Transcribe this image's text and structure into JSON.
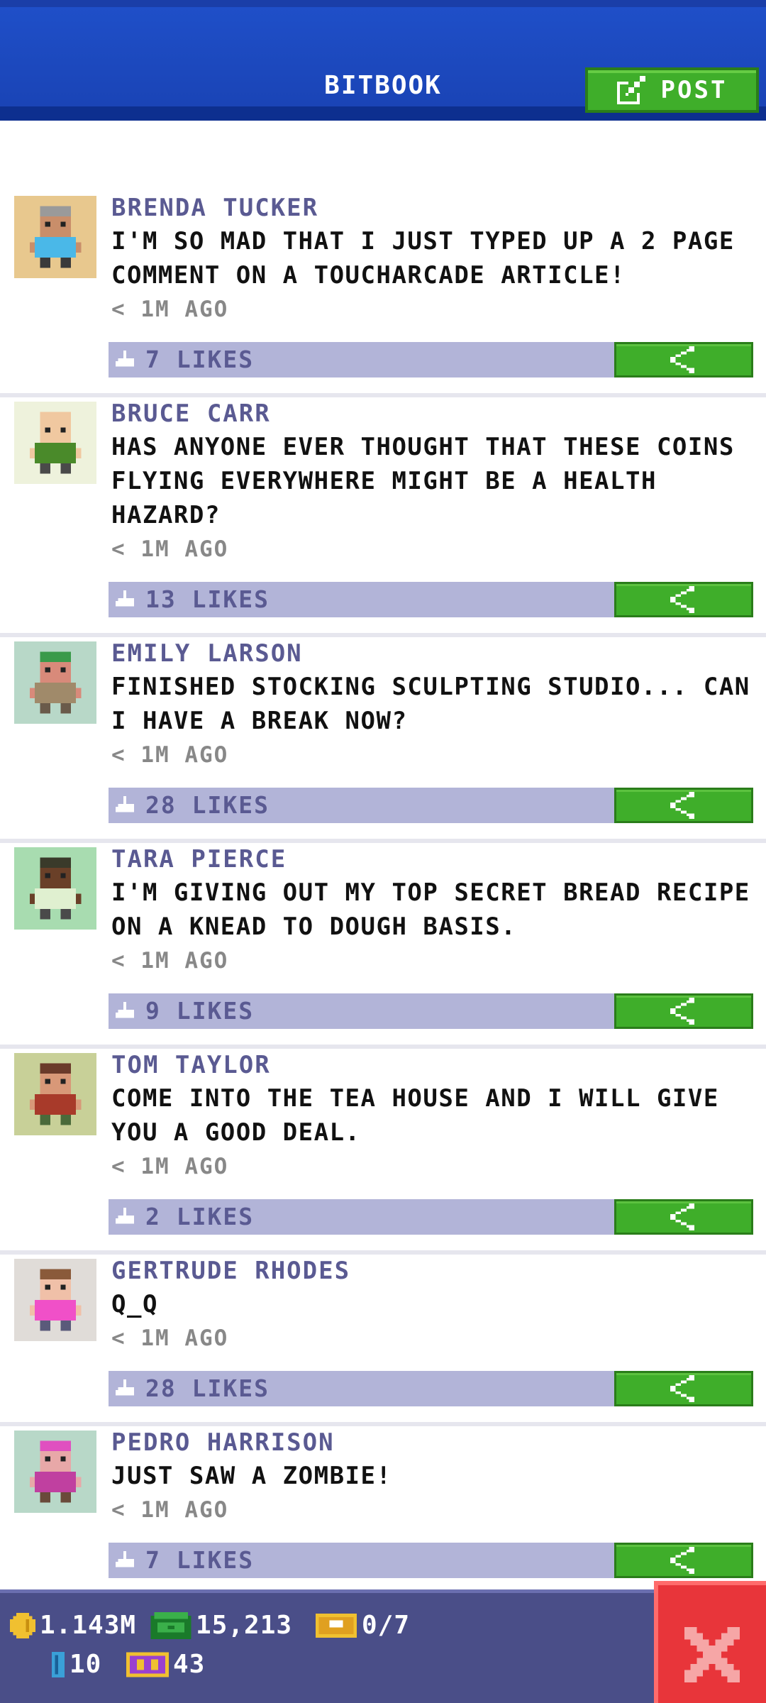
{
  "header": {
    "title": "BITBOOK",
    "post_label": "POST"
  },
  "posts": [
    {
      "author": "BRENDA TUCKER",
      "text": "I'M SO MAD THAT I JUST TYPED UP A 2 PAGE COMMENT ON A TOUCHARCADE ARTICLE!",
      "time": "< 1M AGO",
      "likes": "7 LIKES",
      "avatar_bg": "#e8c88e",
      "skin": "#c98e6a",
      "hair": "#9a9a9a",
      "shirt": "#4ab8e8",
      "pants": "#3a3a3a"
    },
    {
      "author": "BRUCE CARR",
      "text": "HAS ANYONE EVER THOUGHT THAT THESE COINS FLYING EVERYWHERE MIGHT BE A HEALTH HAZARD?",
      "time": "< 1M AGO",
      "likes": "13 LIKES",
      "avatar_bg": "#eef2dc",
      "skin": "#f0c8a0",
      "hair": "#f0c8a0",
      "shirt": "#4a8a2a",
      "pants": "#4a4a4a"
    },
    {
      "author": "EMILY LARSON",
      "text": "FINISHED STOCKING SCULPTING STUDIO... CAN I HAVE A BREAK NOW?",
      "time": "< 1M AGO",
      "likes": "28 LIKES",
      "avatar_bg": "#b8d8c8",
      "skin": "#d88a7a",
      "hair": "#3a9a4a",
      "shirt": "#a08a6a",
      "pants": "#6a5a4a"
    },
    {
      "author": "TARA PIERCE",
      "text": "I'M GIVING OUT MY TOP SECRET BREAD RECIPE ON A KNEAD TO DOUGH BASIS.",
      "time": "< 1M AGO",
      "likes": "9 LIKES",
      "avatar_bg": "#a8dcb0",
      "skin": "#6a4028",
      "hair": "#3a3a2a",
      "shirt": "#e0f0d0",
      "pants": "#4a4a4a"
    },
    {
      "author": "TOM TAYLOR",
      "text": "COME INTO THE TEA HOUSE AND I WILL GIVE YOU A GOOD DEAL.",
      "time": "< 1M AGO",
      "likes": "2 LIKES",
      "avatar_bg": "#c8d098",
      "skin": "#d89878",
      "hair": "#6a3a2a",
      "shirt": "#a83a2a",
      "pants": "#4a6a3a"
    },
    {
      "author": "GERTRUDE RHODES",
      "text": "Q_Q",
      "time": "< 1M AGO",
      "likes": "28 LIKES",
      "avatar_bg": "#e0dcd8",
      "skin": "#f0c0a8",
      "hair": "#8a5a3a",
      "shirt": "#f050c8",
      "pants": "#5a5a7a"
    },
    {
      "author": "PEDRO HARRISON",
      "text": "JUST SAW A ZOMBIE!",
      "time": "< 1M AGO",
      "likes": "7 LIKES",
      "avatar_bg": "#b8d8c8",
      "skin": "#e8a8a8",
      "hair": "#e050c0",
      "shirt": "#c040a0",
      "pants": "#6a4a3a"
    }
  ],
  "status": {
    "coins": "1.143M",
    "bux": "15,213",
    "tickets": "0/7",
    "level_count": "10",
    "stars": "43"
  },
  "colors": {
    "header_blue": "#1f4fc8",
    "accent_green": "#3fae2a",
    "likes_bar": "#b2b4d8",
    "author_purple": "#5a5a92",
    "status_bg": "#4a4e88",
    "close_red": "#e8353a"
  },
  "icons": {
    "post": "edit-icon",
    "share": "share-icon",
    "like": "thumbs-up-icon",
    "coin": "coin-icon",
    "bux": "bux-icon",
    "ticket": "ticket-icon",
    "level": "elevator-icon",
    "stars": "vip-icon",
    "close": "close-icon"
  }
}
